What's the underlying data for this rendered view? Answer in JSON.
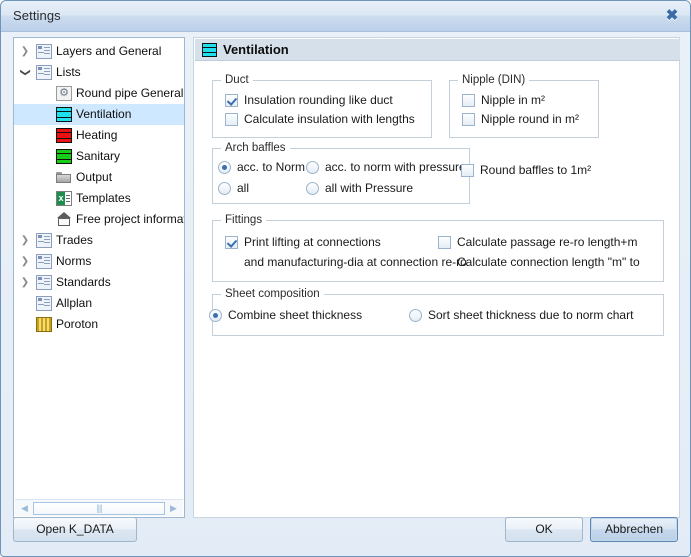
{
  "window": {
    "title": "Settings",
    "close_label": "✖"
  },
  "tree": {
    "items": [
      {
        "label": "Layers and General",
        "icon": "page-icon",
        "twisty": "collapsed",
        "indent": 0,
        "selected": false
      },
      {
        "label": "Lists",
        "icon": "page-icon",
        "twisty": "expanded",
        "indent": 0,
        "selected": false
      },
      {
        "label": "Round pipe General",
        "icon": "gear-icon",
        "twisty": "none",
        "indent": 1,
        "selected": false
      },
      {
        "label": "Ventilation",
        "icon": "duct-cyan-icon",
        "twisty": "none",
        "indent": 1,
        "selected": true
      },
      {
        "label": "Heating",
        "icon": "duct-red-icon",
        "twisty": "none",
        "indent": 1,
        "selected": false
      },
      {
        "label": "Sanitary",
        "icon": "duct-green-icon",
        "twisty": "none",
        "indent": 1,
        "selected": false
      },
      {
        "label": "Output",
        "icon": "folder-icon",
        "twisty": "none",
        "indent": 1,
        "selected": false
      },
      {
        "label": "Templates",
        "icon": "excel-icon",
        "twisty": "none",
        "indent": 1,
        "selected": false
      },
      {
        "label": "Free project informat",
        "icon": "house-icon",
        "twisty": "none",
        "indent": 1,
        "selected": false
      },
      {
        "label": "Trades",
        "icon": "page-icon",
        "twisty": "collapsed",
        "indent": 0,
        "selected": false
      },
      {
        "label": "Norms",
        "icon": "page-icon",
        "twisty": "collapsed",
        "indent": 0,
        "selected": false
      },
      {
        "label": "Standards",
        "icon": "page-icon",
        "twisty": "collapsed",
        "indent": 0,
        "selected": false
      },
      {
        "label": "Allplan",
        "icon": "page-icon",
        "twisty": "none",
        "indent": 0,
        "selected": false
      },
      {
        "label": "Poroton",
        "icon": "brick-icon",
        "twisty": "none",
        "indent": 0,
        "selected": false
      }
    ],
    "twisty_collapsed": "❯",
    "twisty_expanded": "❯",
    "scrollbar": {
      "left_arrow": "◀",
      "right_arrow": "▶",
      "grip": "||||"
    }
  },
  "content": {
    "header": {
      "title": "Ventilation",
      "icon": "duct-cyan-icon"
    },
    "groups": {
      "duct": {
        "title": "Duct",
        "options": [
          {
            "label": "Insulation rounding like duct",
            "checked": true
          },
          {
            "label": "Calculate insulation with lengths",
            "checked": false
          }
        ]
      },
      "nipple": {
        "title": "Nipple (DIN)",
        "options": [
          {
            "label": "Nipple in m²",
            "checked": false
          },
          {
            "label": "Nipple round  in m²",
            "checked": false
          }
        ]
      },
      "arch_baffles": {
        "title": "Arch baffles",
        "options": [
          {
            "label": "acc. to Norm",
            "checked": true
          },
          {
            "label": "acc. to norm with pressure",
            "checked": false
          },
          {
            "label": "all",
            "checked": false
          },
          {
            "label": "all with Pressure",
            "checked": false
          }
        ],
        "extra_checkbox": {
          "label": "Round baffles to  1m²",
          "checked": false
        }
      },
      "fittings": {
        "title": "Fittings",
        "options": [
          {
            "label": "Print lifting at connections",
            "checked": true
          },
          {
            "label": "Calculate passage re-ro length+m",
            "checked": false
          }
        ],
        "sub_texts": [
          "and manufacturing-dia at connection re-ro",
          "Calculate connection length \"m\" to"
        ]
      },
      "sheet_composition": {
        "title": "Sheet composition",
        "options": [
          {
            "label": "Combine sheet thickness",
            "checked": true
          },
          {
            "label": "Sort sheet thickness due to norm chart",
            "checked": false
          }
        ]
      }
    }
  },
  "footer": {
    "open_label": "Open K_DATA",
    "ok_label": "OK",
    "cancel_label": "Abbrechen"
  },
  "colors": {
    "accent": "#3a6fb0",
    "selection": "#cde8ff",
    "header_bg": "#d6e0ea",
    "window_border": "#6f94bc"
  }
}
